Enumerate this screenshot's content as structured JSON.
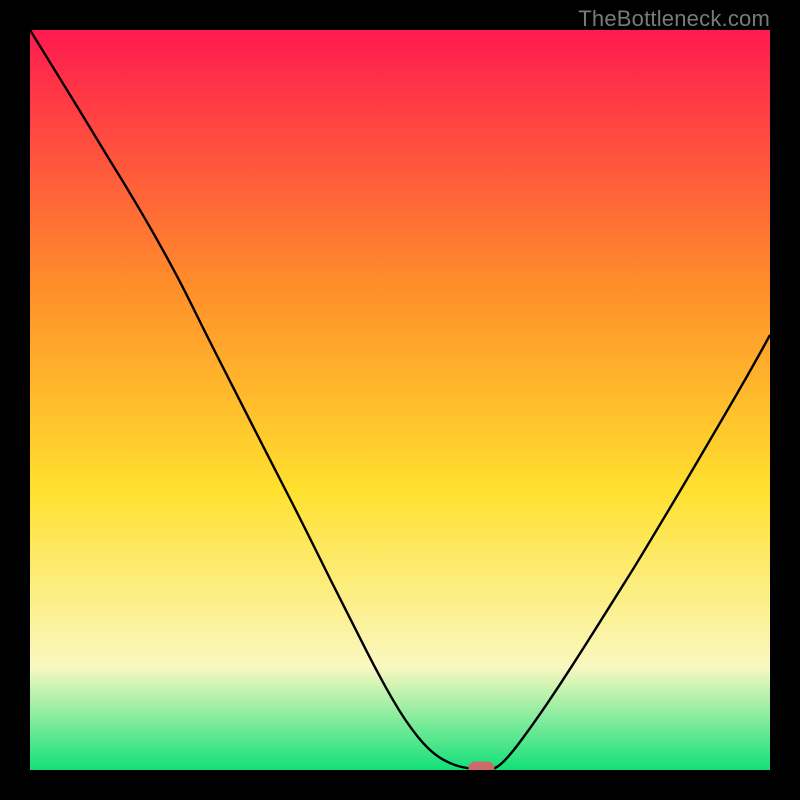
{
  "watermark": "TheBottleneck.com",
  "colors": {
    "gradient_top": "#ff1a4f",
    "gradient_mid1": "#ff8f2a",
    "gradient_mid2": "#ffe02e",
    "gradient_low": "#faf8c0",
    "gradient_bottom": "#12e07a",
    "curve": "#000000",
    "marker": "#cf6a6a",
    "background": "#000000"
  },
  "chart_data": {
    "type": "line",
    "title": "",
    "xlabel": "",
    "ylabel": "",
    "xlim": [
      0,
      100
    ],
    "ylim": [
      0,
      100
    ],
    "series": [
      {
        "name": "bottleneck-curve",
        "x": [
          0.0,
          3.4,
          6.8,
          10.1,
          13.5,
          16.9,
          20.3,
          23.6,
          27.0,
          30.4,
          33.8,
          37.2,
          40.5,
          43.9,
          47.3,
          50.7,
          54.1,
          57.4,
          60.8,
          62.8,
          64.9,
          68.2,
          71.6,
          75.0,
          78.4,
          81.8,
          85.1,
          88.5,
          91.9,
          95.3,
          98.6,
          100.0
        ],
        "y": [
          100.0,
          94.5,
          89.0,
          83.5,
          78.0,
          72.2,
          66.0,
          59.3,
          52.6,
          45.9,
          39.3,
          32.6,
          25.9,
          19.2,
          12.5,
          6.6,
          2.4,
          0.5,
          0.0,
          0.0,
          2.0,
          6.5,
          11.5,
          16.8,
          22.2,
          27.6,
          33.1,
          38.8,
          44.6,
          50.4,
          56.2,
          58.8
        ]
      }
    ],
    "marker": {
      "x": 61.0,
      "y": 0.0,
      "shape": "capsule"
    }
  }
}
